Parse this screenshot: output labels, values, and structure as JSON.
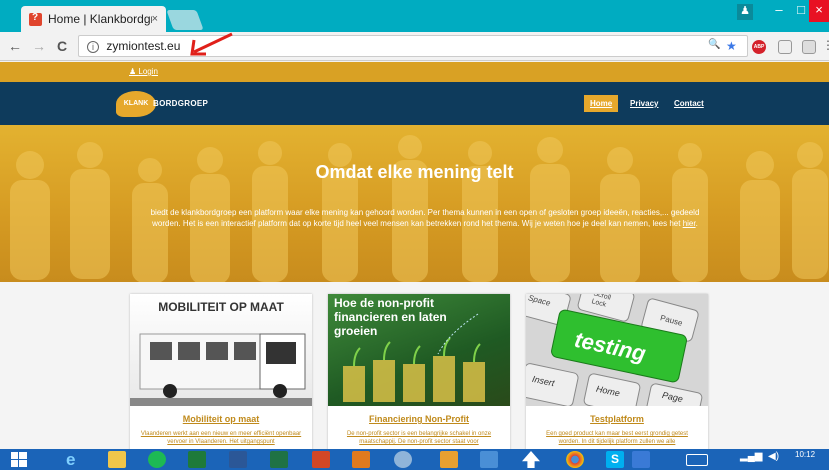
{
  "browser": {
    "tab_title": "Home | Klankbordgroep",
    "tab_close": "×",
    "url": "zymiontest.eu",
    "back": "←",
    "forward": "→",
    "reload": "C",
    "win_min": "–",
    "win_max": "□",
    "win_close": "×",
    "user_icon": "♟",
    "zoom_icon": "🔍",
    "star_icon": "★",
    "ext_abp": "ABP"
  },
  "site": {
    "login": "Login",
    "logo_circle": "KLANK",
    "logo_word": "BORDGROEP",
    "nav": [
      "Home",
      "Privacy",
      "Contact"
    ],
    "hero_title": "Omdat elke mening telt",
    "hero_text_1": "biedt de klankbordgroep een platform waar elke mening kan gehoord worden. Per thema kunnen in een open of gesloten groep ideeën, reacties,... gedeeld worden. Het is een interactief platform dat op korte tijd heel veel mensen kan betrekken rond het thema. Wij je weten hoe je deel kan nemen, lees het ",
    "hero_link": "hier",
    "hero_text_2": ".",
    "cards": [
      {
        "img_text": "MOBILITEIT OP MAAT",
        "title": "Mobiliteit op maat",
        "desc": "Vlaanderen werkt aan een nieuw en meer efficiënt openbaar vervoer in Vlaanderen. Het uitgangspunt"
      },
      {
        "img_text": "Hoe de non-profit financieren en laten groeien",
        "title": "Financiering Non-Profit",
        "desc": "De non-profit sector is een belangrijke schakel in onze maatschappij. De non-profit sector staat voor"
      },
      {
        "img_text": "testing",
        "img_keys": [
          "Space",
          "Scroll Lock",
          "Pause",
          "Insert",
          "Home",
          "Page"
        ],
        "title": "Testplatform",
        "desc": "Een goed product kan maar best eerst grondig getest worden. In dit tijdelijk platform zullen we alle"
      }
    ]
  },
  "taskbar": {
    "time": "10:12"
  },
  "colors": {
    "tabstrip": "#00acc1",
    "gold": "#d9a124",
    "navy": "#0e3b5c",
    "accent": "#e6a82c",
    "taskbar": "#1b64b8"
  }
}
